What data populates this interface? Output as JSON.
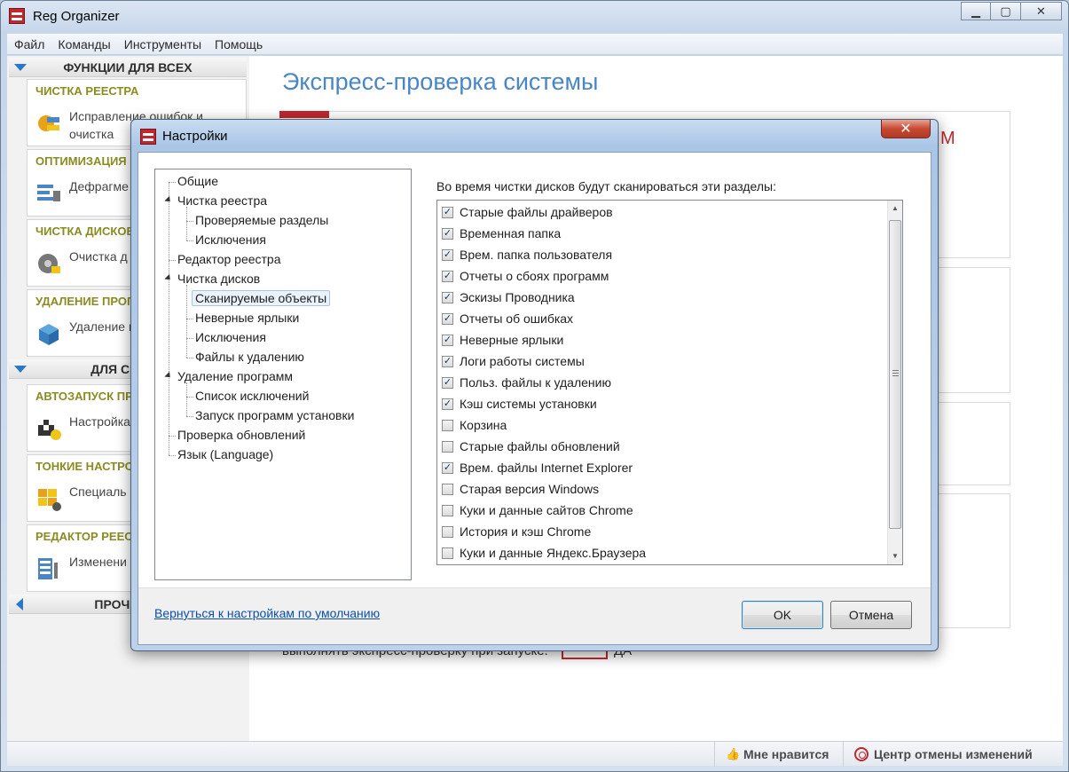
{
  "app": {
    "title": "Reg Organizer"
  },
  "menu": [
    "Файл",
    "Команды",
    "Инструменты",
    "Помощь"
  ],
  "sidebar": {
    "section1": "ФУНКЦИИ ДЛЯ ВСЕХ",
    "section2": "ДЛЯ СПЕЦИ",
    "section3": "ПРОЧИЕ Ф",
    "cards": [
      {
        "title": "ЧИСТКА РЕЕСТРА",
        "desc": "Исправление ошибок и очистка"
      },
      {
        "title": "ОПТИМИЗАЦИЯ Р",
        "desc": "Дефрагме реестра"
      },
      {
        "title": "ЧИСТКА ДИСКОВ",
        "desc": "Очистка д исправлен"
      },
      {
        "title": "УДАЛЕНИЕ ПРОГ",
        "desc": "Удаление программ"
      },
      {
        "title": "АВТОЗАПУСК ПРО",
        "desc": "Настройка автозапус"
      },
      {
        "title": "ТОНКИЕ НАСТРОЙ",
        "desc": "Специаль системы"
      },
      {
        "title": "РЕДАКТОР РЕЕСТ",
        "desc": "Изменени поиск в не"
      }
    ]
  },
  "main": {
    "title": "Экспресс-проверка системы",
    "partial_m": "М",
    "bottom_line": "выполнять экспресс-проверку при запуске:",
    "toggle_label": "ДА"
  },
  "statusbar": {
    "like": "Мне нравится",
    "undo": "Центр отмены изменений"
  },
  "dialog": {
    "title": "Настройки",
    "close_glyph": "✕",
    "tree": [
      "Общие",
      "Чистка реестра",
      "Проверяемые разделы",
      "Исключения",
      "Редактор реестра",
      "Чистка дисков",
      "Сканируемые объекты",
      "Неверные ярлыки",
      "Исключения",
      "Файлы к удалению",
      "Удаление программ",
      "Список исключений",
      "Запуск программ установки",
      "Проверка обновлений",
      "Язык (Language)"
    ],
    "list_caption": "Во время чистки дисков будут сканироваться эти разделы:",
    "items": [
      {
        "label": "Старые файлы драйверов",
        "checked": true
      },
      {
        "label": "Временная папка",
        "checked": true
      },
      {
        "label": "Врем. папка пользователя",
        "checked": true
      },
      {
        "label": "Отчеты о сбоях программ",
        "checked": true
      },
      {
        "label": "Эскизы Проводника",
        "checked": true
      },
      {
        "label": "Отчеты об ошибках",
        "checked": true
      },
      {
        "label": "Неверные ярлыки",
        "checked": true
      },
      {
        "label": "Логи работы системы",
        "checked": true
      },
      {
        "label": "Польз. файлы к удалению",
        "checked": true
      },
      {
        "label": "Кэш системы установки",
        "checked": true
      },
      {
        "label": "Корзина",
        "checked": false
      },
      {
        "label": "Старые файлы обновлений",
        "checked": false
      },
      {
        "label": "Врем. файлы Internet Explorer",
        "checked": true
      },
      {
        "label": "Старая версия Windows",
        "checked": false
      },
      {
        "label": "Куки и данные сайтов Chrome",
        "checked": false
      },
      {
        "label": "История и кэш Chrome",
        "checked": false
      },
      {
        "label": "Куки и данные Яндекс.Браузера",
        "checked": false
      }
    ],
    "reset_link": "Вернуться к настройкам по умолчанию",
    "ok": "OK",
    "cancel": "Отмена"
  },
  "colors": {
    "accent_red": "#c1272d",
    "title_blue": "#4a86c5",
    "card_title": "#8a8b20"
  }
}
